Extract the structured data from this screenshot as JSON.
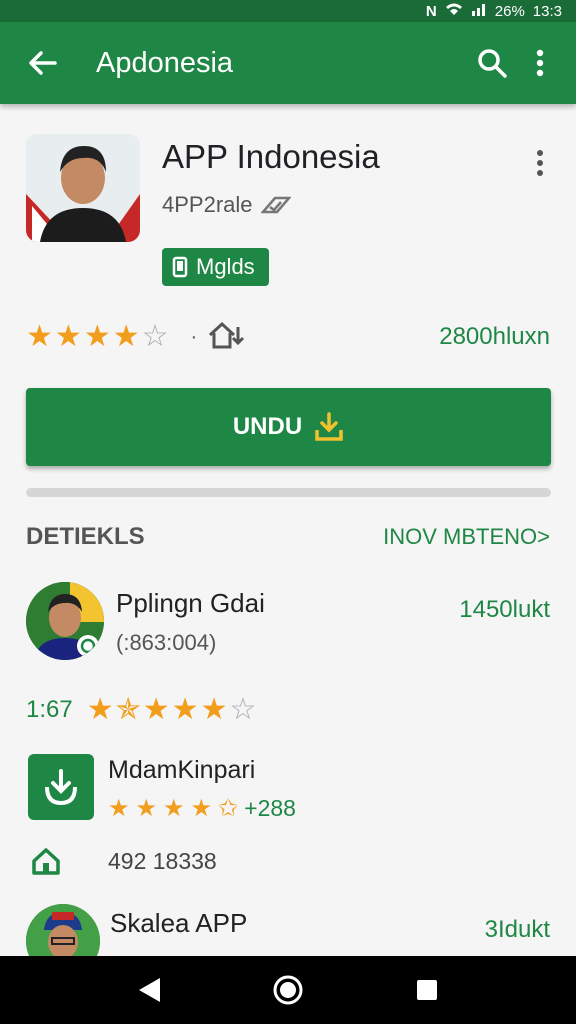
{
  "status_bar": {
    "battery": "26%",
    "time": "13:3"
  },
  "app_bar": {
    "title": "Apdonesia",
    "icons": [
      "back-arrow-icon",
      "search-icon",
      "more-vert-icon"
    ]
  },
  "app": {
    "name": "APP Indonesia",
    "developer": "4PP2rale",
    "badge": "Mglds",
    "rating_stars": 4,
    "downloads": "2800hluxn",
    "install_label": "UNDU"
  },
  "details": {
    "title": "DETIEKLS",
    "link": "INOV MBTENO>"
  },
  "reviews": [
    {
      "name": "Pplingn Gdai",
      "sub": "(:863:004)",
      "count": "1450lukt"
    },
    {
      "name": "MdamKinpari",
      "value": "+288"
    },
    {
      "name": "Skalea APP",
      "count": "3Idukt"
    }
  ],
  "rating_row": {
    "value": "1:67",
    "stars": 4
  },
  "meta": {
    "text": "492 18338"
  },
  "colors": {
    "primary": "#1f8745",
    "primary_dark": "#1b6b38",
    "star": "#f29d1b"
  }
}
